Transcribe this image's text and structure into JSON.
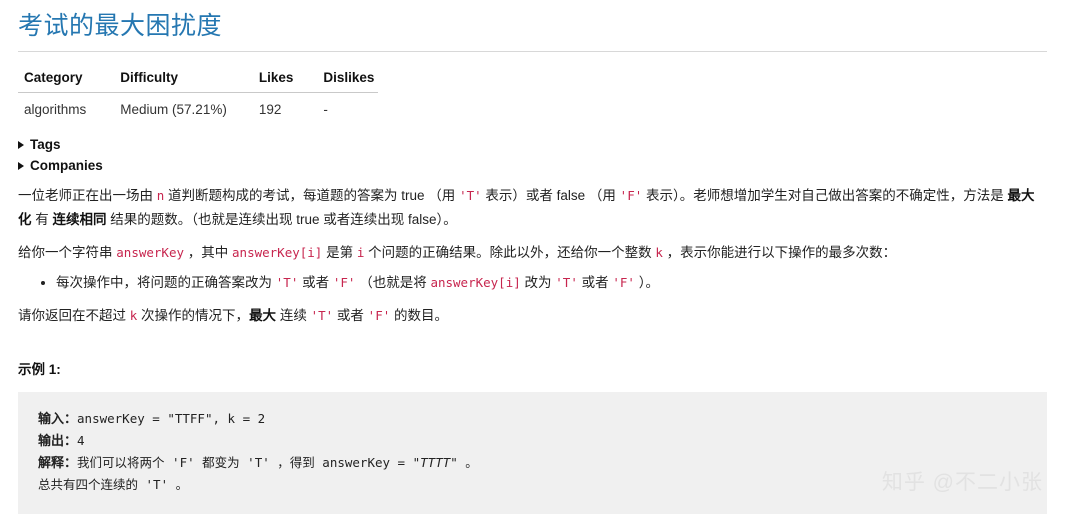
{
  "page": {
    "title": "考试的最大困扰度",
    "title_color": "#2577b1"
  },
  "meta_table": {
    "headers": [
      "Category",
      "Difficulty",
      "Likes",
      "Dislikes"
    ],
    "rows": [
      [
        "algorithms",
        "Medium (57.21%)",
        "192",
        "-"
      ]
    ]
  },
  "collapsibles": [
    {
      "label": "Tags"
    },
    {
      "label": "Companies"
    }
  ],
  "description": {
    "p1": {
      "s1": "一位老师正在出一场由 ",
      "c1": "n",
      "s2": " 道判断题构成的考试，每道题的答案为 true （用 ",
      "c2": "'T'",
      "s3": " 表示）或者 false （用 ",
      "c3": "'F'",
      "s4": " 表示）。老师想增加学生对自己做出答案的不确定性，方法是 ",
      "b1": "最大化",
      "s5": " 有 ",
      "b2": "连续相同",
      "s6": " 结果的题数。（也就是连续出现 true 或者连续出现 false）。"
    },
    "p2": {
      "s1": "给你一个字符串 ",
      "c1": "answerKey",
      "s2": " ，其中 ",
      "c2": "answerKey[i]",
      "s3": " 是第 ",
      "c3": "i",
      "s4": " 个问题的正确结果。除此以外，还给你一个整数 ",
      "c4": "k",
      "s5": " ，表示你能进行以下操作的最多次数："
    },
    "bullet1": {
      "s1": "每次操作中，将问题的正确答案改为 ",
      "c1": "'T'",
      "s2": " 或者 ",
      "c2": "'F'",
      "s3": " （也就是将 ",
      "c3": "answerKey[i]",
      "s4": " 改为 ",
      "c4": "'T'",
      "s5": " 或者 ",
      "c5": "'F'",
      "s6": " ）。"
    },
    "p3": {
      "s1": "请你返回在不超过 ",
      "c1": "k",
      "s2": " 次操作的情况下，",
      "b1": "最大",
      "s3": " 连续 ",
      "c2": "'T'",
      "s4": " 或者 ",
      "c3": "'F'",
      "s5": " 的数目。"
    }
  },
  "example": {
    "label": "示例 1:",
    "input_label": "输入：",
    "input_value": "answerKey = \"TTFF\", k = 2",
    "output_label": "输出：",
    "output_value": "4",
    "explain_label": "解释：",
    "explain_s1": "我们可以将两个 'F' 都变为 'T' ，得到 answerKey = \"",
    "explain_italic": "TTTT",
    "explain_s2": "\" 。",
    "explain_line2": "总共有四个连续的 'T' 。"
  },
  "watermark": {
    "text": "知乎 @不二小张"
  }
}
